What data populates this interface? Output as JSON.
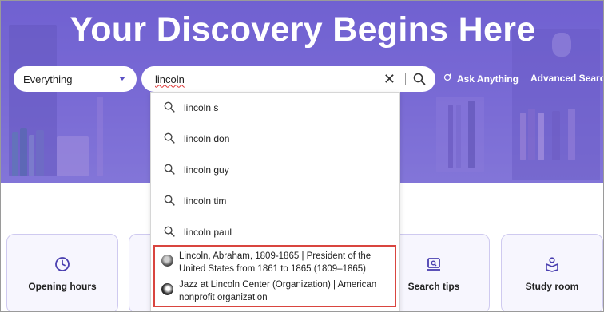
{
  "hero": {
    "title": "Your Discovery Begins Here"
  },
  "search": {
    "scope_value": "Everything",
    "query_value": "lincoln",
    "ask_label": "Ask Anything",
    "advanced_label": "Advanced Search"
  },
  "suggestions": [
    {
      "text": "lincoln s"
    },
    {
      "text": "lincoln don"
    },
    {
      "text": "lincoln guy"
    },
    {
      "text": "lincoln tim"
    },
    {
      "text": "lincoln paul"
    }
  ],
  "entities": [
    {
      "text": "Lincoln, Abraham, 1809-1865 | President of the United States from 1861 to 1865 (1809–1865)"
    },
    {
      "text": "Jazz at Lincoln Center (Organization) | American nonprofit organization"
    }
  ],
  "cards": [
    {
      "label": "Opening hours",
      "icon": "clock-icon"
    },
    {
      "label": "",
      "icon": ""
    },
    {
      "label": "Search tips",
      "icon": "screen-search-icon"
    },
    {
      "label": "Study room",
      "icon": "study-person-icon"
    }
  ],
  "colors": {
    "hero_purple": "#7463d2",
    "accent": "#5a4fc4",
    "highlight_border": "#d9453f",
    "card_bg": "#f7f6fe"
  }
}
